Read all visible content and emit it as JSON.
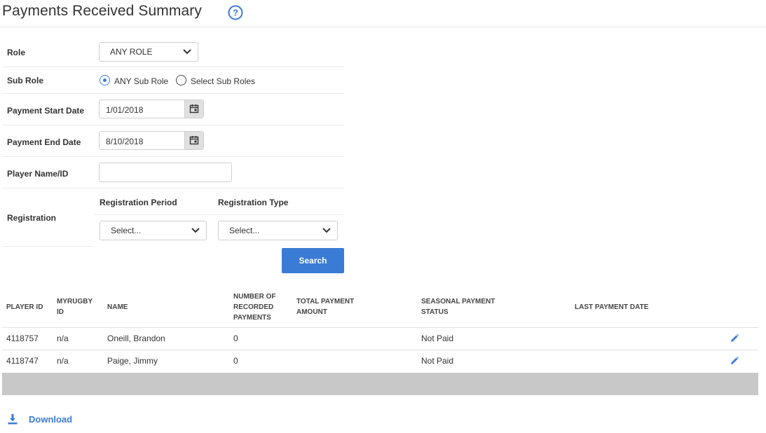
{
  "header": {
    "title": "Payments Received Summary",
    "help_icon": "question-circle-icon"
  },
  "filters": {
    "role": {
      "label": "Role",
      "value": "ANY ROLE"
    },
    "sub_role": {
      "label": "Sub Role",
      "option_any": "ANY Sub Role",
      "option_select": "Select Sub Roles",
      "selected": "any"
    },
    "payment_start_date": {
      "label": "Payment Start Date",
      "value": "1/01/2018"
    },
    "payment_end_date": {
      "label": "Payment End Date",
      "value": "8/10/2018"
    },
    "player_name_id": {
      "label": "Player Name/ID",
      "value": ""
    },
    "registration": {
      "label": "Registration",
      "period": {
        "header": "Registration Period",
        "value": "Select..."
      },
      "type": {
        "header": "Registration Type",
        "value": "Select..."
      }
    },
    "search_label": "Search"
  },
  "table": {
    "columns": {
      "player_id": "PLAYER ID",
      "myrugby_id_1": "MYRUGBY",
      "myrugby_id_2": "ID",
      "name": "NAME",
      "num_1": "NUMBER OF",
      "num_2": "RECORDED",
      "num_3": "PAYMENTS",
      "total_1": "TOTAL PAYMENT",
      "total_2": "AMOUNT",
      "status_1": "SEASONAL PAYMENT",
      "status_2": "STATUS",
      "last_date": "LAST PAYMENT DATE"
    },
    "rows": [
      {
        "player_id": "4118757",
        "myrugby_id": "n/a",
        "name": "Oneill, Brandon",
        "num_payments": "0",
        "total": "",
        "status": "Not Paid",
        "last_date": ""
      },
      {
        "player_id": "4118747",
        "myrugby_id": "n/a",
        "name": "Paige, Jimmy",
        "num_payments": "0",
        "total": "",
        "status": "Not Paid",
        "last_date": ""
      }
    ]
  },
  "download": {
    "label": "Download"
  },
  "colors": {
    "accent": "#3a7bd5",
    "footer_band": "#c8c8c8"
  }
}
